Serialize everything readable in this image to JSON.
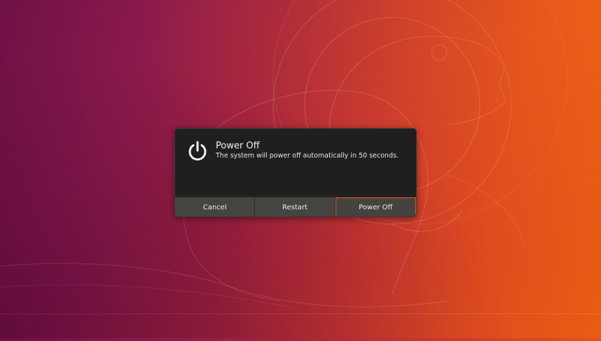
{
  "desktop": {
    "wallpaper_name": "ubuntu-bionic-beaver-wallpaper"
  },
  "dialog": {
    "icon": "power-icon",
    "title": "Power Off",
    "message": "The system will power off automatically in 50 seconds.",
    "buttons": {
      "cancel": "Cancel",
      "restart": "Restart",
      "power_off": "Power Off"
    },
    "accent_color": "#e9541c",
    "background_color": "#1f1f1f",
    "button_color": "#444440"
  }
}
